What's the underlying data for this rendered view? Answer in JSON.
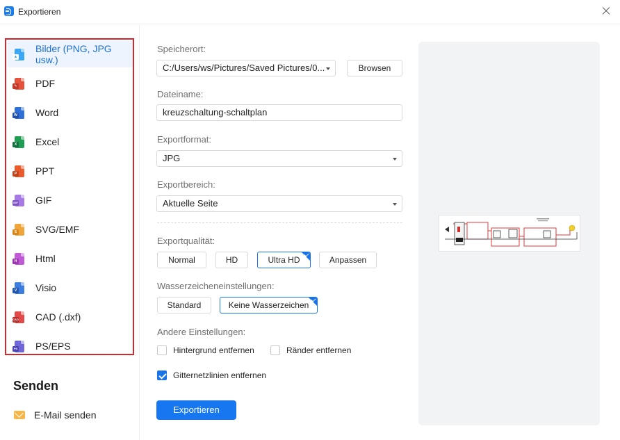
{
  "window": {
    "title": "Exportieren"
  },
  "sidebar": {
    "formats": [
      {
        "label": "Bilder (PNG, JPG usw.)",
        "icon": "image-file-icon",
        "color": "#3ba7f4",
        "tag": "",
        "active": true
      },
      {
        "label": "PDF",
        "icon": "pdf-file-icon",
        "color": "#e5533d",
        "tag": "",
        "active": false
      },
      {
        "label": "Word",
        "icon": "word-file-icon",
        "color": "#2f6fd8",
        "tag": "W",
        "active": false
      },
      {
        "label": "Excel",
        "icon": "excel-file-icon",
        "color": "#1f9d55",
        "tag": "X",
        "active": false
      },
      {
        "label": "PPT",
        "icon": "ppt-file-icon",
        "color": "#ea5a2c",
        "tag": "P",
        "active": false
      },
      {
        "label": "GIF",
        "icon": "gif-file-icon",
        "color": "#a77ae6",
        "tag": "GIF",
        "active": false
      },
      {
        "label": "SVG/EMF",
        "icon": "svg-file-icon",
        "color": "#f0a53a",
        "tag": "S",
        "active": false
      },
      {
        "label": "Html",
        "icon": "html-file-icon",
        "color": "#c15ad6",
        "tag": "H",
        "active": false
      },
      {
        "label": "Visio",
        "icon": "visio-file-icon",
        "color": "#3c7ddf",
        "tag": "V",
        "active": false
      },
      {
        "label": "CAD (.dxf)",
        "icon": "cad-file-icon",
        "color": "#e24a4a",
        "tag": "CAD",
        "active": false
      },
      {
        "label": "PS/EPS",
        "icon": "ps-file-icon",
        "color": "#6f67d9",
        "tag": "PS",
        "active": false
      }
    ],
    "send_title": "Senden",
    "email_label": "E-Mail senden"
  },
  "form": {
    "location_label": "Speicherort:",
    "location_value": "C:/Users/ws/Pictures/Saved Pictures/0...",
    "browse_label": "Browsen",
    "filename_label": "Dateiname:",
    "filename_value": "kreuzschaltung-schaltplan",
    "format_label": "Exportformat:",
    "format_value": "JPG",
    "range_label": "Exportbereich:",
    "range_value": "Aktuelle Seite",
    "quality_label": "Exportqualität:",
    "quality_options": [
      {
        "label": "Normal",
        "selected": false
      },
      {
        "label": "HD",
        "selected": false
      },
      {
        "label": "Ultra HD",
        "selected": true
      },
      {
        "label": "Anpassen",
        "selected": false
      }
    ],
    "watermark_label": "Wasserzeicheneinstellungen:",
    "watermark_options": [
      {
        "label": "Standard",
        "selected": false
      },
      {
        "label": "Keine Wasserzeichen",
        "selected": true
      }
    ],
    "other_label": "Andere Einstellungen:",
    "checkboxes": [
      {
        "label": "Hintergrund entfernen",
        "checked": false
      },
      {
        "label": "Ränder entfernen",
        "checked": false
      },
      {
        "label": "Gitternetzlinien entfernen",
        "checked": true
      }
    ],
    "export_label": "Exportieren"
  },
  "preview": {
    "wire_color": "#e03a3a",
    "accent_color": "#1677f0"
  }
}
